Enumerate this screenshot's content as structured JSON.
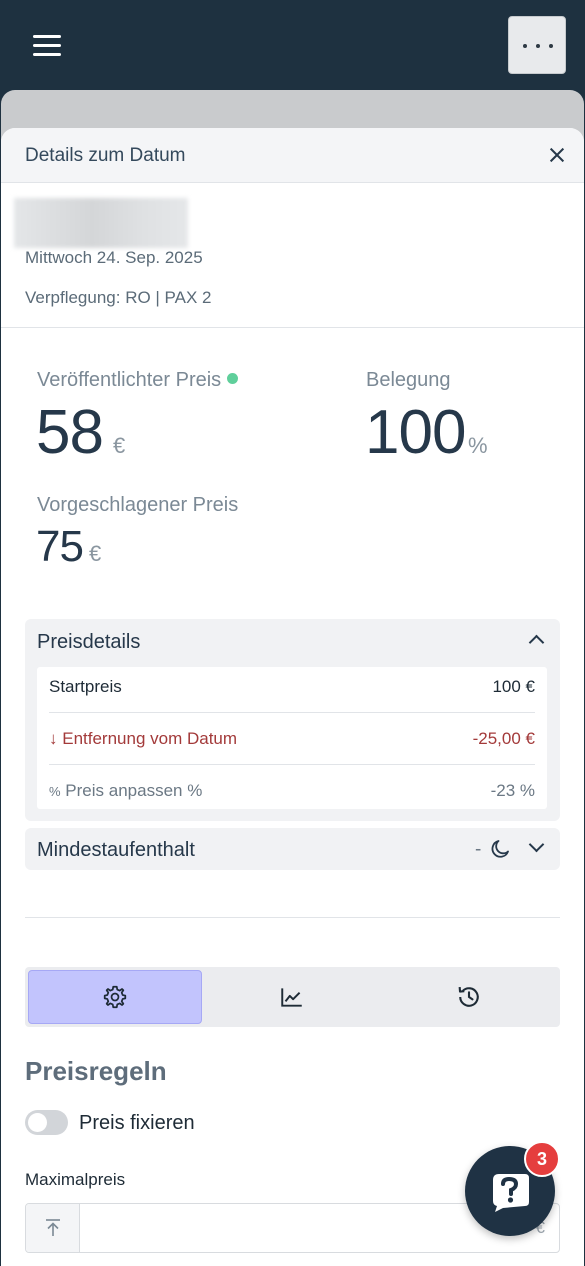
{
  "header": {
    "menu_icon": "hamburger-icon",
    "more_icon": "more-horizontal-icon"
  },
  "sheet": {
    "title": "Details zum Datum",
    "close_icon": "close-icon"
  },
  "date_info": {
    "date": "Mittwoch 24. Sep. 2025",
    "board": "Verpflegung: RO | PAX 2"
  },
  "stats": {
    "published_label": "Veröffentlichter Preis",
    "published_value": "58",
    "published_unit": "€",
    "occupancy_label": "Belegung",
    "occupancy_value": "100",
    "occupancy_unit": "%",
    "suggested_label": "Vorgeschlagener Preis",
    "suggested_value": "75",
    "suggested_unit": "€"
  },
  "price_details": {
    "title": "Preisdetails",
    "rows": [
      {
        "label": "Startpreis",
        "value": "100 €"
      },
      {
        "icon": "↓",
        "label": "Entfernung vom Datum",
        "value": "-25,00 €"
      },
      {
        "icon": "%",
        "label": "Preis anpassen %",
        "value": "-23 %"
      }
    ]
  },
  "min_stay": {
    "title": "Mindestaufenthalt",
    "value": "-",
    "icon": "moon-icon"
  },
  "tabs": [
    {
      "icon": "gear-icon",
      "active": true
    },
    {
      "icon": "line-chart-icon",
      "active": false
    },
    {
      "icon": "history-icon",
      "active": false
    }
  ],
  "rules": {
    "title": "Preisregeln",
    "toggle_label": "Preis fixieren",
    "max_price_label": "Maximalpreis",
    "max_price_value": "",
    "max_price_unit": "€"
  },
  "help": {
    "icon": "help-chat-icon",
    "badge": "3"
  },
  "colors": {
    "topbar": "#1e3140",
    "accent_tab": "#c2c4fd",
    "negative": "#a33a3a",
    "status_dot": "#5fcf9b",
    "badge": "#e53e3e"
  }
}
